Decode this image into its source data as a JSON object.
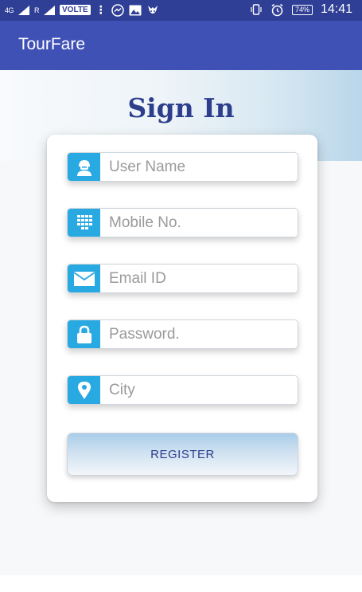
{
  "status_bar": {
    "network": "4G",
    "network_secondary": "R",
    "volte": "VOLTE",
    "battery": "74%",
    "time": "14:41"
  },
  "app_bar": {
    "title": "TourFare"
  },
  "page": {
    "heading": "Sign In"
  },
  "form": {
    "fields": [
      {
        "icon": "user-icon",
        "placeholder": "User Name",
        "value": ""
      },
      {
        "icon": "dialpad-icon",
        "placeholder": "Mobile No.",
        "value": ""
      },
      {
        "icon": "envelope-icon",
        "placeholder": "Email ID",
        "value": ""
      },
      {
        "icon": "lock-icon",
        "placeholder": "Password.",
        "value": ""
      },
      {
        "icon": "location-pin-icon",
        "placeholder": "City",
        "value": ""
      }
    ],
    "register_label": "REGISTER"
  },
  "colors": {
    "status_bar": "#2f3f96",
    "app_bar": "#3f51b5",
    "icon_background": "#29a9e1",
    "heading": "#2d3e8d"
  }
}
